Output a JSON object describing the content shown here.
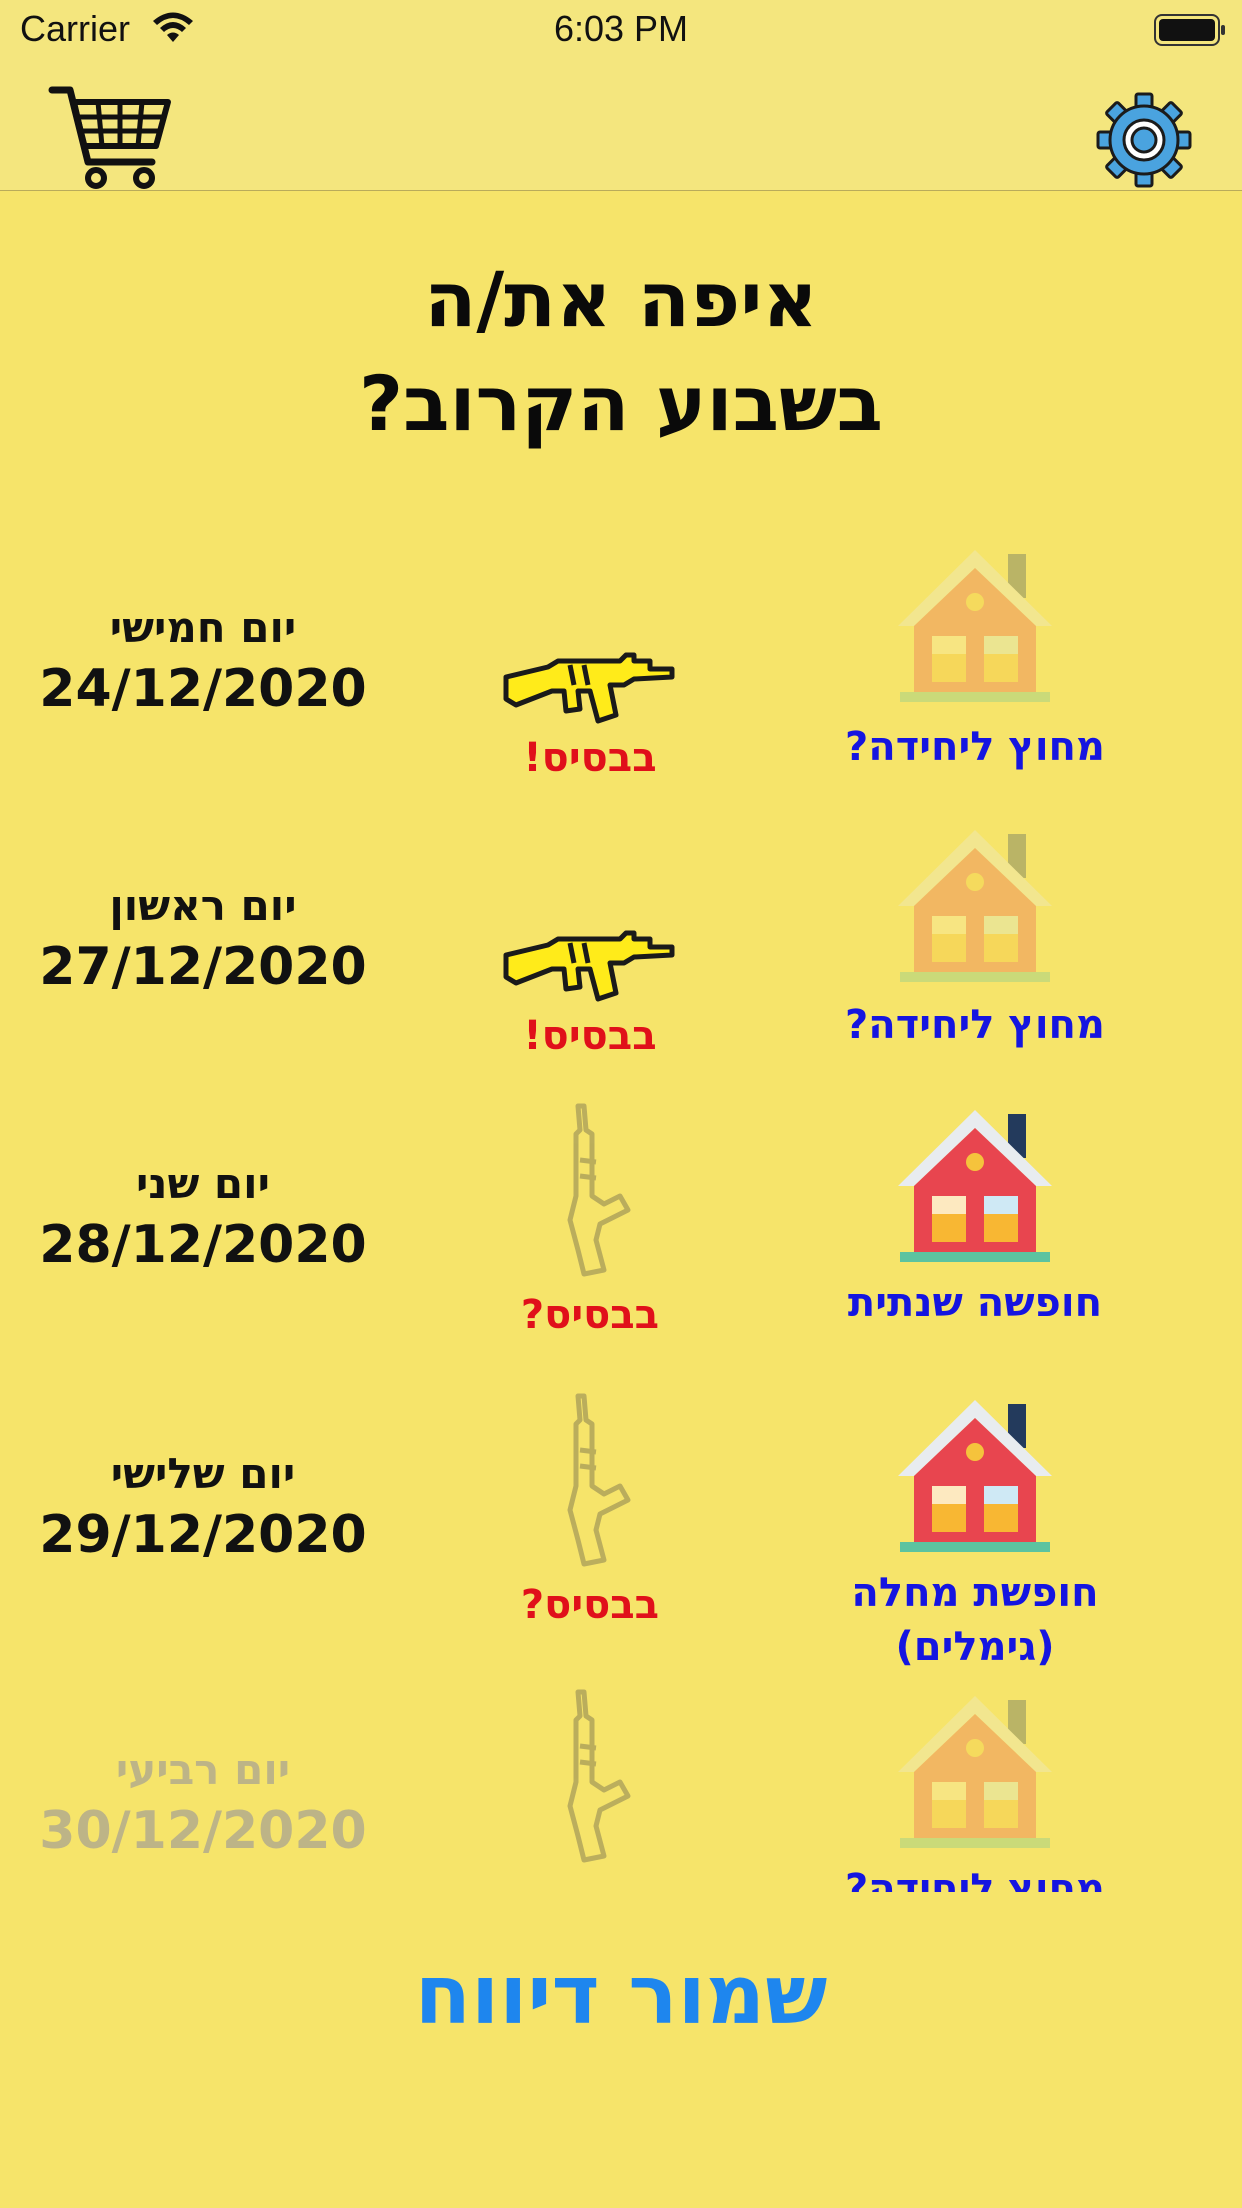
{
  "status_bar": {
    "carrier": "Carrier",
    "time": "6:03 PM"
  },
  "header": {
    "cart_icon": "shopping-cart-icon",
    "settings_icon": "gear-icon"
  },
  "title": {
    "line1": "איפה את/ה",
    "line2": "בשבוע הקרוב?"
  },
  "rows": [
    {
      "day": "יום חמישי",
      "date": "24/12/2020",
      "base_label": "בבסיס!",
      "location_label": "מחוץ ליחידה?"
    },
    {
      "day": "יום ראשון",
      "date": "27/12/2020",
      "base_label": "בבסיס!",
      "location_label": "מחוץ ליחידה?"
    },
    {
      "day": "יום שני",
      "date": "28/12/2020",
      "base_label": "בבסיס?",
      "location_label": "חופשה שנתית"
    },
    {
      "day": "יום שלישי",
      "date": "29/12/2020",
      "base_label": "בבסיס?",
      "location_label": "חופשת מחלה (גימלים)"
    },
    {
      "day": "יום רביעי",
      "date": "30/12/2020",
      "base_label": "",
      "location_label": "מחוץ ליחידה?"
    }
  ],
  "save_button": {
    "label": "שמור דיווח"
  },
  "colors": {
    "background": "#f6e46a",
    "base_label": "#e0101a",
    "location_label": "#1515e0",
    "save": "#1e86ee"
  }
}
